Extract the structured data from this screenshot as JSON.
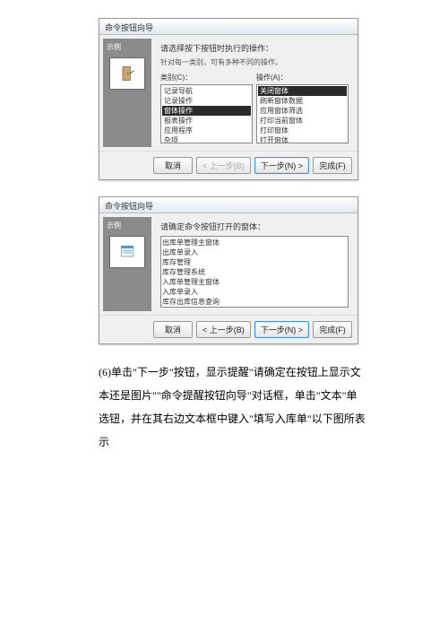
{
  "dialog1": {
    "title": "命令按钮向导",
    "sidebar_label": "示例",
    "prompt": "请选择按下按钮时执行的操作：",
    "hint": "针对每一类别，可有多种不同的操作。",
    "cat_label": "类别(C)：",
    "act_label": "操作(A)：",
    "categories": [
      {
        "label": "记录导航",
        "sel": false
      },
      {
        "label": "记录操作",
        "sel": false
      },
      {
        "label": "窗体操作",
        "sel": true
      },
      {
        "label": "报表操作",
        "sel": false
      },
      {
        "label": "应用程序",
        "sel": false
      },
      {
        "label": "杂项",
        "sel": false
      }
    ],
    "actions": [
      {
        "label": "关闭窗体",
        "sel": true
      },
      {
        "label": "刷新窗体数据",
        "sel": false
      },
      {
        "label": "应用窗体筛选",
        "sel": false
      },
      {
        "label": "打印当前窗体",
        "sel": false
      },
      {
        "label": "打印窗体",
        "sel": false
      },
      {
        "label": "打开窗体",
        "sel": false
      }
    ],
    "btn_cancel": "取消",
    "btn_back": "< 上一步(B)",
    "btn_next": "下一步(N) >",
    "btn_finish": "完成(F)"
  },
  "dialog2": {
    "title": "命令按钮向导",
    "sidebar_label": "示例",
    "prompt": "请确定命令按钮打开的窗体：",
    "forms": [
      {
        "label": "出库单管理主窗体",
        "sel": false
      },
      {
        "label": "出库单录入",
        "sel": false
      },
      {
        "label": "库存管理",
        "sel": false
      },
      {
        "label": "库存管理系统",
        "sel": false
      },
      {
        "label": "入库单管理主窗体",
        "sel": false
      },
      {
        "label": "入库单录入",
        "sel": true
      },
      {
        "label": "库存出库信息查询",
        "sel": false
      }
    ],
    "btn_cancel": "取消",
    "btn_back": "< 上一步(B)",
    "btn_next": "下一步(N) >",
    "btn_finish": "完成(F)"
  },
  "caption": "(6)单击\"下一步\"按钮，显示提醒\"请确定在按钮上显示文本还是图片\"\"命令提醒按钮向导\"对话框，单击\"文本\"单选钮，并在其右边文本框中键入\"填写入库单\"以下图所表示"
}
